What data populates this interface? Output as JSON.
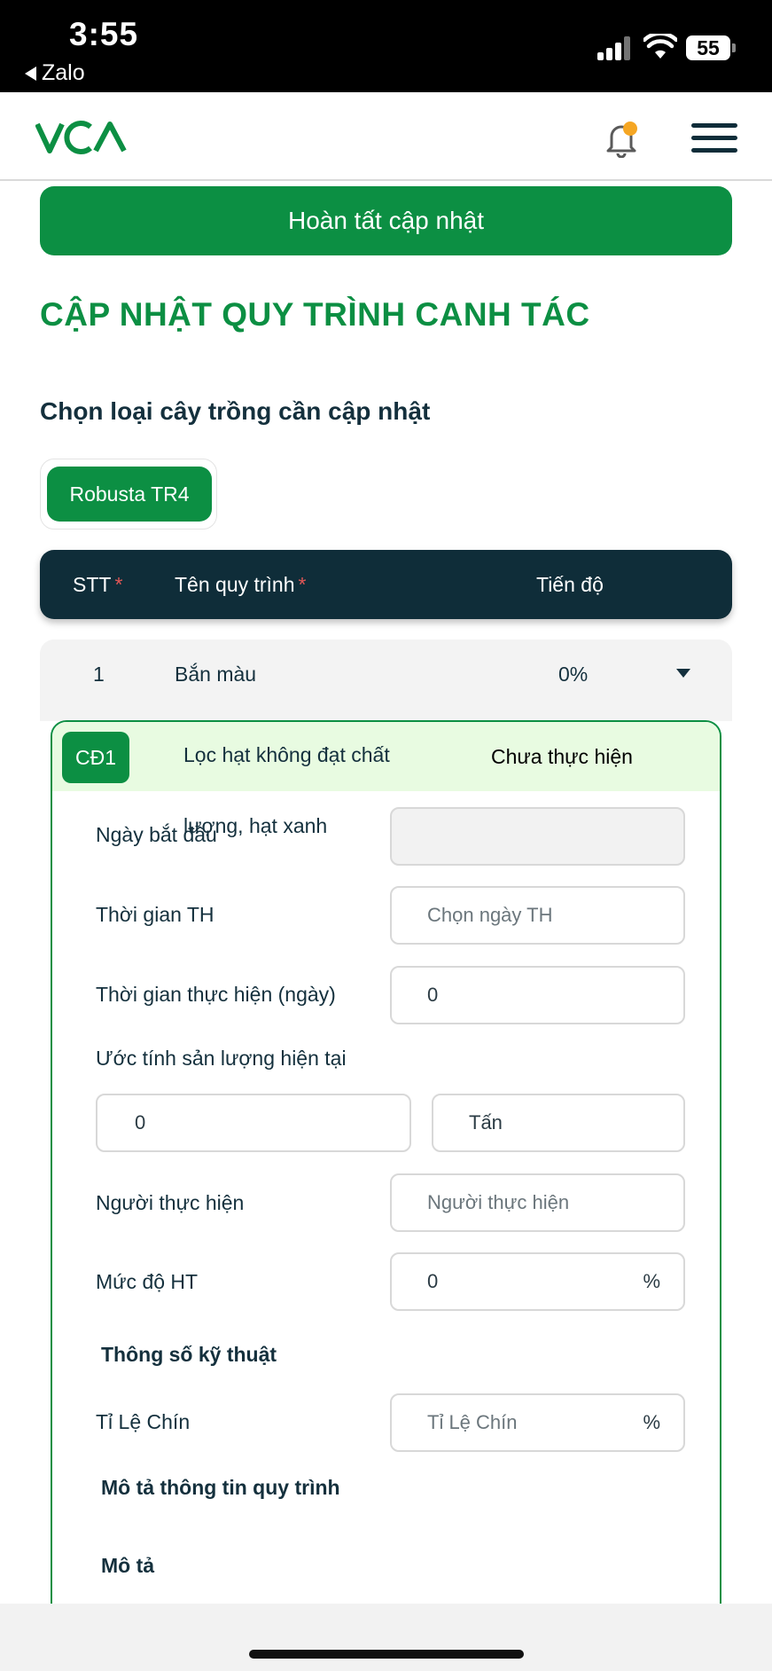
{
  "status_bar": {
    "time": "3:55",
    "back_app": "Zalo",
    "battery": "55",
    "icons": [
      "signal-icon",
      "wifi-icon",
      "battery-icon"
    ]
  },
  "header": {
    "logo": "VCA",
    "icons": [
      "bell-icon",
      "menu-icon"
    ],
    "notification_color": "#f5a623"
  },
  "actions": {
    "complete_update": "Hoàn tất cập nhật"
  },
  "page": {
    "title": "CẬP NHẬT QUY TRÌNH CANH TÁC",
    "select_crop_label": "Chọn loại cây trồng cần cập nhật",
    "crop_chip": "Robusta TR4"
  },
  "table": {
    "headers": {
      "stt": "STT",
      "name": "Tên quy trình",
      "progress": "Tiến độ",
      "required_mark": "*"
    },
    "row": {
      "stt": "1",
      "name": "Bắn màu",
      "progress": "0%"
    }
  },
  "step": {
    "code": "CĐ1",
    "name_line1": "Lọc hạt không đạt chất",
    "name_line2": "lượng, hạt xanh",
    "status": "Chưa thực hiện"
  },
  "form": {
    "start_date_label": "Ngày bắt đầu",
    "start_date_value": "",
    "exec_time_label": "Thời gian TH",
    "exec_time_placeholder": "Chọn ngày TH",
    "duration_label": "Thời gian thực hiện (ngày)",
    "duration_value": "0",
    "yield_label": "Ước tính sản lượng hiện tại",
    "yield_value": "0",
    "yield_unit": "Tấn",
    "performer_label": "Người thực hiện",
    "performer_placeholder": "Người thực hiện",
    "completion_label": "Mức độ HT",
    "completion_value": "0",
    "completion_unit": "%",
    "tech_heading": "Thông số kỹ thuật",
    "ripe_ratio_label": "Tỉ Lệ Chín",
    "ripe_ratio_placeholder": "Tỉ Lệ Chín",
    "ripe_ratio_unit": "%",
    "desc_heading": "Mô tả thông tin quy trình",
    "desc_label": "Mô tả"
  },
  "colors": {
    "brand_green": "#0c8f43",
    "dark_navy": "#0f2d39",
    "step_header_bg": "#e8fbe1",
    "required_red": "#e05656"
  }
}
